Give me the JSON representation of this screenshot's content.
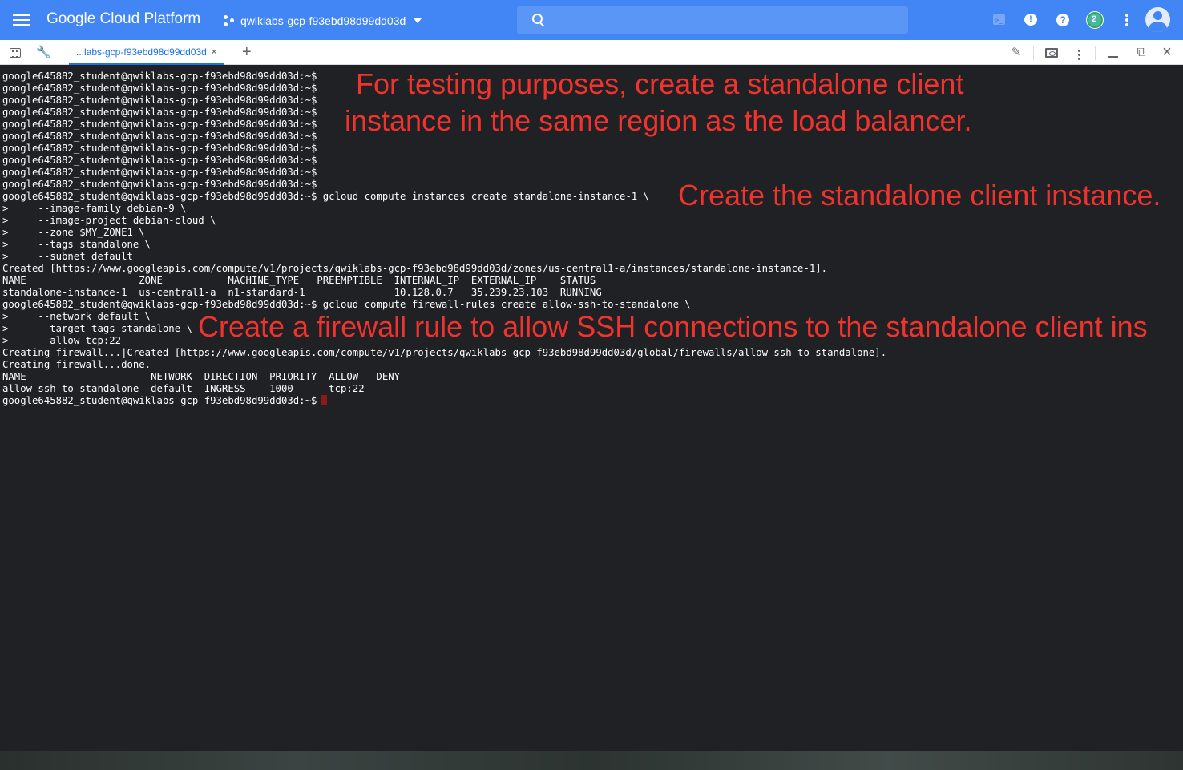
{
  "header": {
    "brand": "Google Cloud Platform",
    "project": "qwiklabs-gcp-f93ebd98d99dd03d",
    "notification_count": "2",
    "colors": {
      "bar": "#4285f4",
      "search": "#5a96f6"
    }
  },
  "tabbar": {
    "tab_label": "...labs-gcp-f93ebd98d99dd03d",
    "close_glyph": "×",
    "add_glyph": "+"
  },
  "terminal": {
    "lines": [
      "google645882_student@qwiklabs-gcp-f93ebd98d99dd03d:~$",
      "google645882_student@qwiklabs-gcp-f93ebd98d99dd03d:~$",
      "google645882_student@qwiklabs-gcp-f93ebd98d99dd03d:~$",
      "google645882_student@qwiklabs-gcp-f93ebd98d99dd03d:~$",
      "google645882_student@qwiklabs-gcp-f93ebd98d99dd03d:~$",
      "google645882_student@qwiklabs-gcp-f93ebd98d99dd03d:~$",
      "google645882_student@qwiklabs-gcp-f93ebd98d99dd03d:~$",
      "google645882_student@qwiklabs-gcp-f93ebd98d99dd03d:~$",
      "google645882_student@qwiklabs-gcp-f93ebd98d99dd03d:~$",
      "google645882_student@qwiklabs-gcp-f93ebd98d99dd03d:~$",
      "google645882_student@qwiklabs-gcp-f93ebd98d99dd03d:~$ gcloud compute instances create standalone-instance-1 \\",
      ">     --image-family debian-9 \\",
      ">     --image-project debian-cloud \\",
      ">     --zone $MY_ZONE1 \\",
      ">     --tags standalone \\",
      ">     --subnet default",
      "Created [https://www.googleapis.com/compute/v1/projects/qwiklabs-gcp-f93ebd98d99dd03d/zones/us-central1-a/instances/standalone-instance-1].",
      "NAME                   ZONE           MACHINE_TYPE   PREEMPTIBLE  INTERNAL_IP  EXTERNAL_IP    STATUS",
      "standalone-instance-1  us-central1-a  n1-standard-1               10.128.0.7   35.239.23.103  RUNNING",
      "google645882_student@qwiklabs-gcp-f93ebd98d99dd03d:~$ gcloud compute firewall-rules create allow-ssh-to-standalone \\",
      ">     --network default \\",
      ">     --target-tags standalone \\",
      ">     --allow tcp:22",
      "Creating firewall...|Created [https://www.googleapis.com/compute/v1/projects/qwiklabs-gcp-f93ebd98d99dd03d/global/firewalls/allow-ssh-to-standalone].",
      "Creating firewall...done.",
      "NAME                     NETWORK  DIRECTION  PRIORITY  ALLOW   DENY",
      "allow-ssh-to-standalone  default  INGRESS    1000      tcp:22"
    ],
    "prompt": "google645882_student@qwiklabs-gcp-f93ebd98d99dd03d:~$",
    "colors": {
      "background": "#202124",
      "text": "#ffffff",
      "cursor": "#8b1a1a"
    }
  },
  "annotations": {
    "a1_line1": "For testing purposes, create a standalone client",
    "a1_line2": "instance in the same region as the load balancer.",
    "a2": "Create the standalone client instance.",
    "a3": "Create a firewall rule to allow SSH connections to the standalone client ins",
    "color": "#f0332d"
  }
}
